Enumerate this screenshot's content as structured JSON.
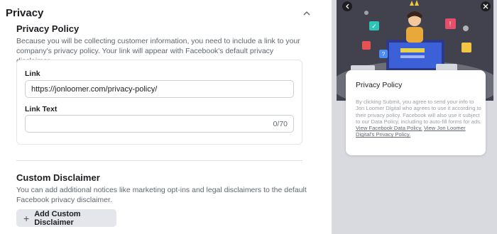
{
  "section": {
    "title": "Privacy"
  },
  "privacy_policy": {
    "title": "Privacy Policy",
    "description": "Because you will be collecting customer information, you need to include a link to your company's privacy policy. Your link will appear with Facebook's default privacy disclaimer.",
    "link_label": "Link",
    "link_value": "https://jonloomer.com/privacy-policy/",
    "link_text_label": "Link Text",
    "link_text_value": "",
    "link_text_counter": "0/70"
  },
  "custom_disclaimer": {
    "title": "Custom Disclaimer",
    "description": "You can add additional notices like marketing opt-ins and legal disclaimers to the default Facebook privacy disclaimer.",
    "add_button_label": "Add Custom Disclaimer"
  },
  "preview": {
    "card_title": "Privacy Policy",
    "body_text": "By clicking Submit, you agree to send your info to Jon Loomer Digital who agrees to use it according to their privacy policy. Facebook will also use it subject to our Data Policy, including to auto-fill forms for ads.",
    "link_data_policy": "View Facebook Data Policy.",
    "link_privacy_policy": "View Jon Loomer Digital's Privacy Policy."
  },
  "icons": {
    "collapse": "chevron-up-icon",
    "add": "plus-icon",
    "prev": "chevron-left-icon",
    "next": "chevron-right-icon"
  },
  "colors": {
    "text_primary": "#1c1e21",
    "text_secondary": "#606770",
    "button_bg": "#e4e6eb",
    "preview_bg": "#d9dadf",
    "hero_bg": "#3e3f4a"
  }
}
